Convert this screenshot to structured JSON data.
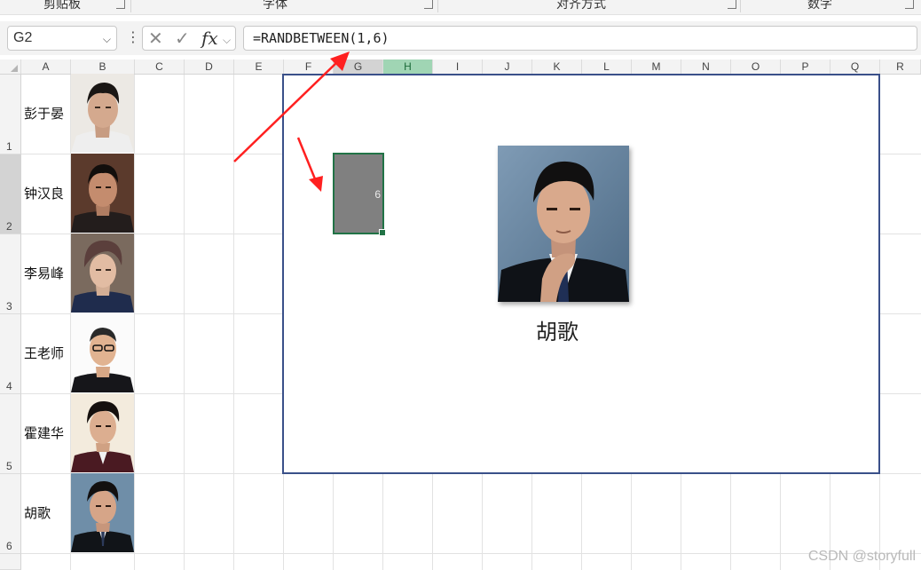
{
  "ribbon": {
    "groups": [
      "剪贴板",
      "字体",
      "对齐方式",
      "数字"
    ]
  },
  "formula_bar": {
    "name_box": "G2",
    "formula": "=RANDBETWEEN(1,6)",
    "fx_label": "fx"
  },
  "columns": [
    "A",
    "B",
    "C",
    "D",
    "E",
    "F",
    "G",
    "H",
    "I",
    "J",
    "K",
    "L",
    "M",
    "N",
    "O",
    "P",
    "Q",
    "R"
  ],
  "selected_column": "H",
  "selected_row": "2",
  "rows": [
    {
      "num": "1",
      "name": "彭于晏"
    },
    {
      "num": "2",
      "name": "钟汉良"
    },
    {
      "num": "3",
      "name": "李易峰"
    },
    {
      "num": "4",
      "name": "王老师"
    },
    {
      "num": "5",
      "name": "霍建华"
    },
    {
      "num": "6",
      "name": "胡歌"
    }
  ],
  "random_cell": {
    "value": "6"
  },
  "display": {
    "name": "胡歌"
  },
  "watermark": "CSDN @storyfull",
  "colors": {
    "accent_green": "#217346",
    "panel_border": "#3a5089",
    "arrow": "#ff2020",
    "gray_box": "#808080"
  }
}
